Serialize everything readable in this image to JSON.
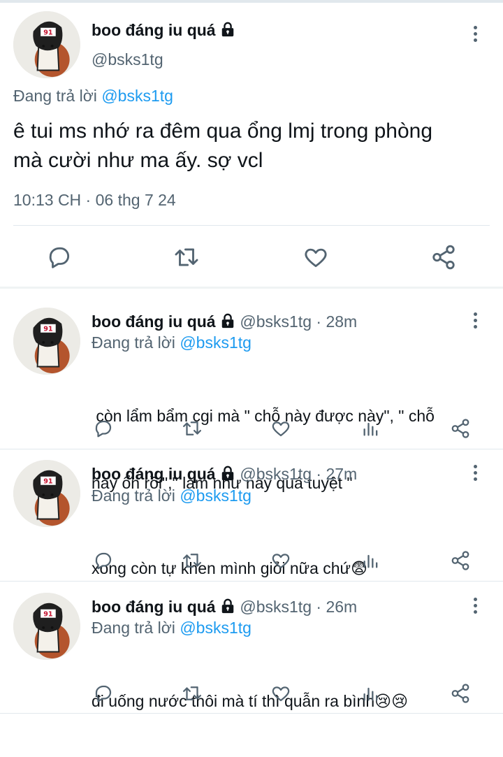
{
  "main_tweet": {
    "display_name": "boo đáng iu quá",
    "handle": "@bsks1tg",
    "reply_prefix": "Đang trả lời",
    "reply_to": "@bsks1tg",
    "text_line1": "ê tui ms nhớ ra đêm qua ổng lmj trong phòng",
    "text_line2": "mà cười như ma ấy. sợ vcl",
    "meta": "10:13 CH · 06 thg 7 24"
  },
  "replies": [
    {
      "display_name": "boo đáng iu quá",
      "handle": "@bsks1tg",
      "time": "· 28m",
      "reply_prefix": "Đang trả lời",
      "reply_to": "@bsks1tg",
      "text_line1": " còn lẩm bẩm cgi mà \" chỗ này được này\", \" chỗ",
      "text_line2": "này ổn rồi\",\" làm như này quá tuyệt \""
    },
    {
      "display_name": "boo đáng iu quá",
      "handle": "@bsks1tg",
      "time": "· 27m",
      "reply_prefix": "Đang trả lời",
      "reply_to": "@bsks1tg",
      "text_line1": "xong còn tự khen mình giỏi nữa chứ😨"
    },
    {
      "display_name": "boo đáng iu quá",
      "handle": "@bsks1tg",
      "time": "· 26m",
      "reply_prefix": "Đang trả lời",
      "reply_to": "@bsks1tg",
      "text_line1": "đi uống nước thôi mà tí thì quẫn ra bình😢😢"
    }
  ],
  "icons": {
    "reply": "reply-icon",
    "retweet": "retweet-icon",
    "like": "heart-icon",
    "views": "views-icon",
    "share": "share-icon",
    "more": "more-vertical-icon",
    "lock": "lock-icon"
  },
  "colors": {
    "link": "#1d9bf0",
    "secondary_text": "#536471",
    "icon": "#536471"
  }
}
